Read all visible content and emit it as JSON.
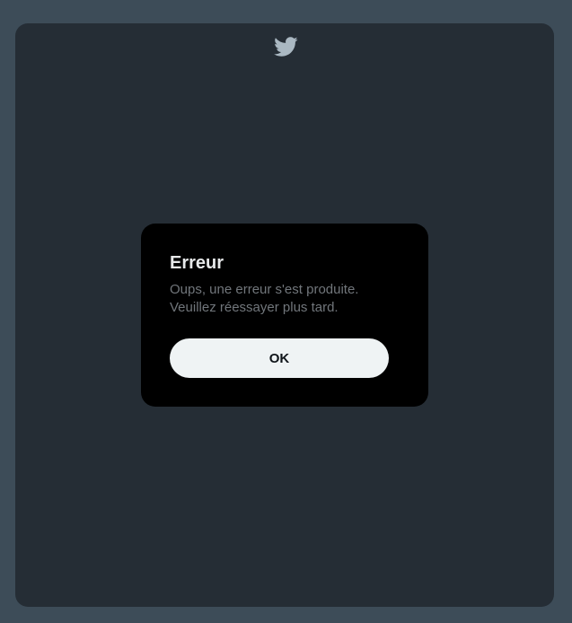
{
  "brand": {
    "logo_icon": "twitter-bird-icon",
    "logo_color": "#aab8c2"
  },
  "dialog": {
    "title": "Erreur",
    "message": "Oups, une erreur s'est produite. Veuillez réessayer plus tard.",
    "ok_label": "OK"
  },
  "colors": {
    "page_background": "#3d4c58",
    "modal_background": "#252d35",
    "dialog_background": "#000000",
    "button_background": "#eff3f4"
  }
}
